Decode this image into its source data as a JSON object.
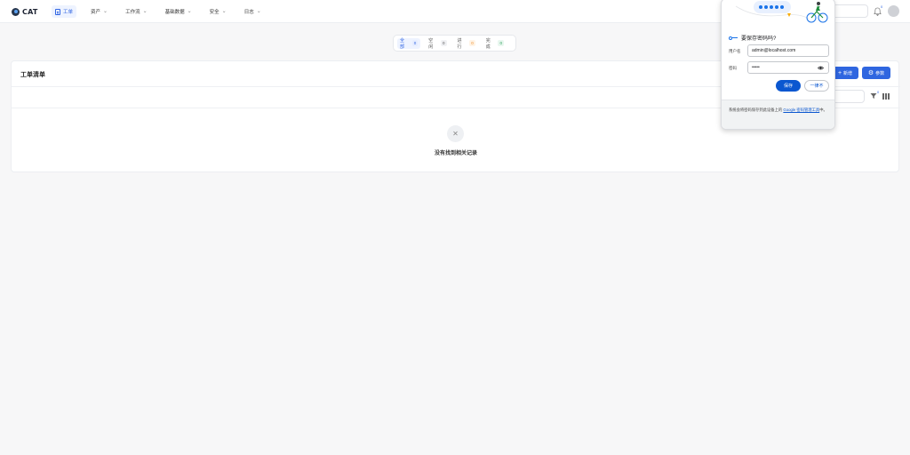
{
  "app": {
    "name": "CAT"
  },
  "nav": {
    "items": [
      {
        "label": "工单",
        "active": true
      },
      {
        "label": "资产"
      },
      {
        "label": "工作流"
      },
      {
        "label": "基础数据"
      },
      {
        "label": "安全"
      },
      {
        "label": "日志"
      }
    ]
  },
  "header": {
    "notification_count": "0"
  },
  "filters": [
    {
      "label": "全部",
      "count": "0"
    },
    {
      "label": "空闲",
      "count": "0"
    },
    {
      "label": "进行",
      "count": "0"
    },
    {
      "label": "完成",
      "count": "0"
    }
  ],
  "card": {
    "title": "工单清单",
    "new_label": "新增",
    "param_label": "参数",
    "filter_count": "0",
    "empty_text": "没有找到相关记录"
  },
  "password_prompt": {
    "question": "要保存密码吗?",
    "username_label": "用户名",
    "username_value": "admin@localhost.com",
    "password_label": "密码",
    "password_mask": "•••••",
    "save_label": "保存",
    "later_label": "一律不",
    "footer_text": "系统会将密码保存到此设备上的",
    "footer_link": "Google 密码管理工具",
    "footer_suffix": "中。"
  },
  "colors": {
    "primary": "#2f66e0",
    "google_blue": "#0b57d0"
  }
}
